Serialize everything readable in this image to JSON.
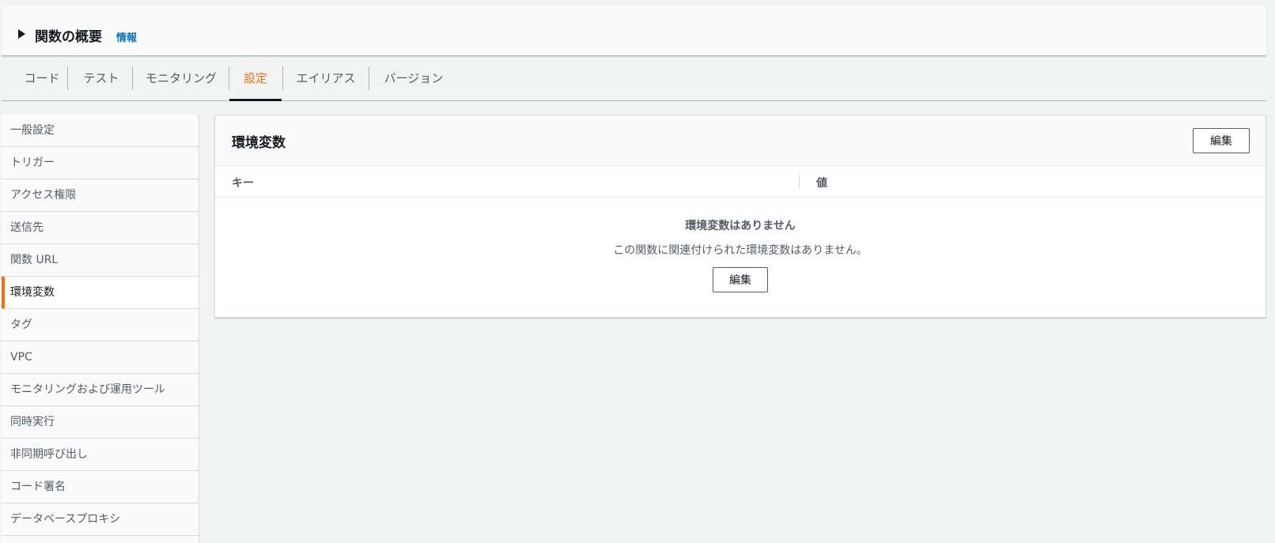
{
  "overview": {
    "title": "関数の概要",
    "info_link": "情報"
  },
  "tabs": [
    {
      "label": "コード"
    },
    {
      "label": "テスト"
    },
    {
      "label": "モニタリング"
    },
    {
      "label": "設定",
      "active": true
    },
    {
      "label": "エイリアス"
    },
    {
      "label": "バージョン"
    }
  ],
  "sidebar": {
    "items": [
      {
        "label": "一般設定"
      },
      {
        "label": "トリガー"
      },
      {
        "label": "アクセス権限"
      },
      {
        "label": "送信先"
      },
      {
        "label": "関数 URL"
      },
      {
        "label": "環境変数",
        "active": true
      },
      {
        "label": "タグ"
      },
      {
        "label": "VPC"
      },
      {
        "label": "モニタリングおよび運用ツール"
      },
      {
        "label": "同時実行"
      },
      {
        "label": "非同期呼び出し"
      },
      {
        "label": "コード署名"
      },
      {
        "label": "データベースプロキシ"
      }
    ]
  },
  "panel": {
    "title": "環境変数",
    "edit_label": "編集",
    "columns": {
      "key": "キー",
      "value": "値"
    },
    "empty": {
      "title": "環境変数はありません",
      "description": "この関数に関連付けられた環境変数はありません。",
      "edit_label": "編集"
    }
  },
  "colors": {
    "accent": "#ec7211",
    "link": "#0073bb"
  }
}
